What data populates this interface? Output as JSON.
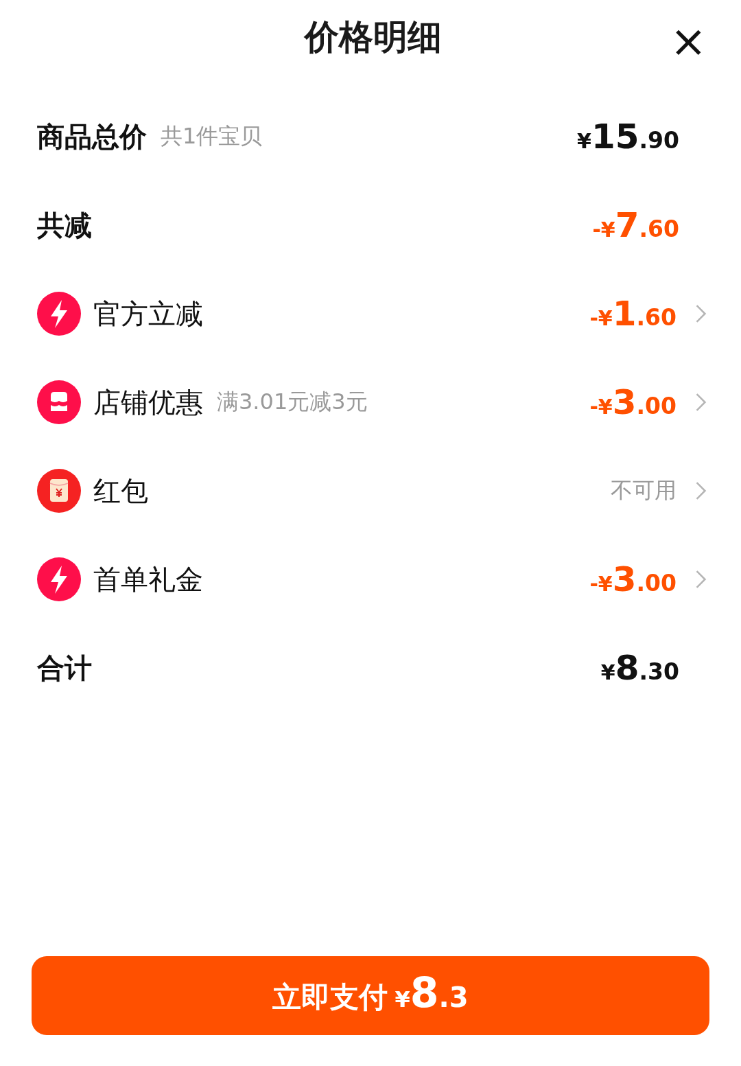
{
  "header": {
    "title": "价格明细",
    "close": "×"
  },
  "rows": [
    {
      "kind": "summary",
      "label": "商品总价",
      "note": "共1件宝贝",
      "amount": "¥15.90",
      "highlight": false
    },
    {
      "kind": "summary",
      "label": "共减",
      "amount": "-¥7.60",
      "highlight": true
    },
    {
      "kind": "bolt",
      "label": "官方立减",
      "amount": "-¥1.60",
      "highlight": true
    },
    {
      "kind": "store",
      "label": "店铺优惠",
      "note": "满3.01元减3元",
      "amount": "-¥3.00",
      "highlight": true
    },
    {
      "kind": "envelope",
      "label": "红包",
      "status": "不可用",
      "highlight": false
    },
    {
      "kind": "bolt",
      "label": "首单礼金",
      "amount": "-¥3.00",
      "highlight": true
    },
    {
      "kind": "summary",
      "label": "合计",
      "amount": "¥8.30",
      "highlight": false
    }
  ],
  "pay_button": {
    "label": "立即支付",
    "amount": "¥8.3"
  }
}
